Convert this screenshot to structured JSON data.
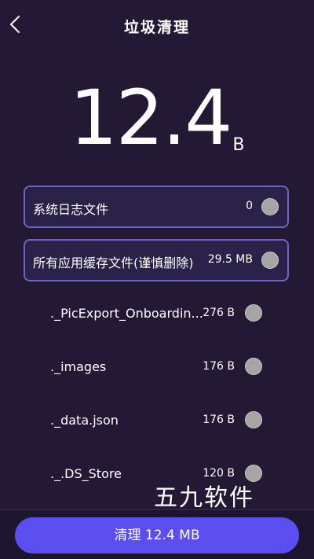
{
  "header": {
    "title": "垃圾清理",
    "back_icon": "chevron-left-icon"
  },
  "summary": {
    "size_value": "12.4",
    "size_unit": "B"
  },
  "categories": [
    {
      "label": "系统日志文件",
      "size": "0",
      "selected": false
    },
    {
      "label": "所有应用缓存文件(谨慎删除)",
      "size": "29.5 MB",
      "selected": false
    }
  ],
  "files": [
    {
      "name": "._PicExport_Onboardin...",
      "size": "276 B",
      "selected": false
    },
    {
      "name": "._images",
      "size": "176 B",
      "selected": false
    },
    {
      "name": "._data.json",
      "size": "176 B",
      "selected": false
    },
    {
      "name": "._.DS_Store",
      "size": "120 B",
      "selected": false
    }
  ],
  "watermark": "五九软件",
  "action": {
    "clean_label": "清理 12.4 MB"
  },
  "colors": {
    "background": "#231935",
    "card_border": "#6e63c9",
    "button": "#5b4ef0",
    "radio": "#a5a5a5"
  }
}
